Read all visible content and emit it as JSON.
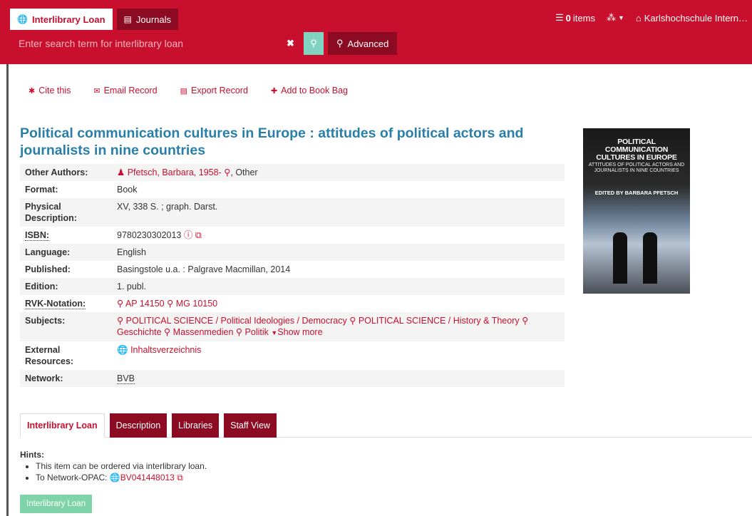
{
  "header": {
    "tabs": [
      {
        "label": "Interlibrary Loan",
        "icon": "globe-icon"
      },
      {
        "label": "Journals",
        "icon": "newspaper-icon"
      }
    ],
    "cart_count": "0",
    "cart_label": "items",
    "institution": "Karlshochschule Intern…"
  },
  "search": {
    "placeholder": "Enter search term for interlibrary loan",
    "value": "",
    "advanced_label": "Advanced"
  },
  "actions": {
    "cite": "Cite this",
    "email": "Email Record",
    "export": "Export Record",
    "bookbag": "Add to Book Bag"
  },
  "record": {
    "title": "Political communication cultures in Europe : attitudes of political actors and journalists in nine countries",
    "labels": {
      "other_authors": "Other Authors:",
      "format": "Format:",
      "physical": "Physical Description:",
      "isbn": "ISBN:",
      "language": "Language:",
      "published": "Published:",
      "edition": "Edition:",
      "rvk": "RVK-Notation:",
      "subjects": "Subjects:",
      "external": "External Resources:",
      "network": "Network:"
    },
    "author": "Pfetsch, Barbara, 1958-",
    "author_role": ", Other",
    "format": "Book",
    "physical": "XV, 338 S. ; graph. Darst.",
    "isbn": "9780230302013",
    "language": "English",
    "published": "Basingstole u.a. : Palgrave Macmillan, 2014",
    "edition": "1. publ.",
    "rvk": [
      "AP 14150",
      "MG 10150"
    ],
    "subjects": [
      "POLITICAL SCIENCE / Political Ideologies / Democracy",
      "POLITICAL SCIENCE / History & Theory",
      "Geschichte",
      "Massenmedien",
      "Politik"
    ],
    "show_more": "Show more",
    "external": "Inhaltsverzeichnis",
    "network": "BVB"
  },
  "cover": {
    "title": "POLITICAL COMMUNICATION CULTURES IN EUROPE",
    "subtitle": "ATTITUDES OF POLITICAL ACTORS AND JOURNALISTS IN NINE COUNTRIES",
    "editor": "EDITED BY BARBARA PFETSCH"
  },
  "tabs": [
    "Interlibrary Loan",
    "Description",
    "Libraries",
    "Staff View"
  ],
  "hints": {
    "title": "Hints:",
    "line1": "This item can be ordered via interlibrary loan.",
    "line2_prefix": "To Network-OPAC:",
    "opac_id": "BV041448013",
    "button": "Interlibrary Loan"
  },
  "colors": {
    "brand": "#c8102e",
    "brand_dark": "#8c0a22",
    "title": "#2a7fa8",
    "accent": "#7fd3c0"
  }
}
